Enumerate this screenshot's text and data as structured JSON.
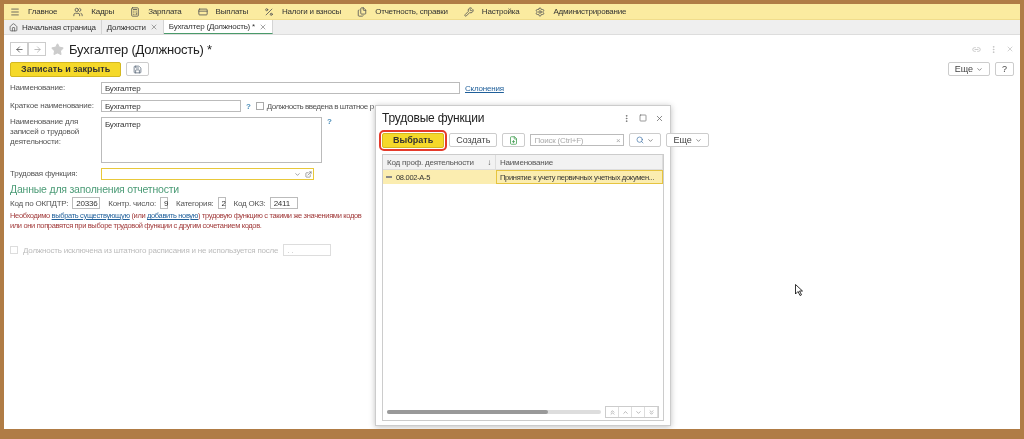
{
  "main_menu": [
    {
      "label": "Главное"
    },
    {
      "label": "Кадры"
    },
    {
      "label": "Зарплата"
    },
    {
      "label": "Выплаты"
    },
    {
      "label": "Налоги и взносы"
    },
    {
      "label": "Отчетность, справки"
    },
    {
      "label": "Настройка"
    },
    {
      "label": "Администрирование"
    }
  ],
  "open_tabs": [
    {
      "label": "Начальная страница",
      "selected": false,
      "closable": false,
      "home": true
    },
    {
      "label": "Должности",
      "selected": false,
      "closable": true,
      "home": false
    },
    {
      "label": "Бухгалтер (Должность) *",
      "selected": true,
      "closable": true,
      "home": false
    }
  ],
  "form": {
    "title": "Бухгалтер (Должность) *",
    "save_close": "Записать и закрыть",
    "more": "Еще",
    "help": "?",
    "name": {
      "label": "Наименование:",
      "value": "Бухгалтер",
      "link": "Склонения"
    },
    "short_name": {
      "label": "Краткое наименование:",
      "value": "Бухгалтер",
      "hint": "?",
      "staff_checkbox": {
        "label": "Должность введена в штатное р",
        "checked": false
      }
    },
    "work_record_name": {
      "label": "Наименование для записей о трудовой деятельности:",
      "value": "Бухгалтер",
      "hint": "?"
    },
    "labor_function": {
      "label": "Трудовая функция:"
    },
    "reporting_header": "Данные для заполнения отчетности",
    "codes": [
      {
        "label": "Код по ОКПДТР:",
        "value": "20336"
      },
      {
        "label": "Контр. число:",
        "value": "9"
      },
      {
        "label": "Категория:",
        "value": "2"
      },
      {
        "label": "Код ОКЗ:",
        "value": "2411"
      }
    ],
    "warning": {
      "before": "Необходимо ",
      "link1": "выбрать существующую",
      "middle1": " (или ",
      "link2": "добавить новую",
      "after": ") трудовую функцию с такими же значениями кодов",
      "line2": "или они поправятся при выборе трудовой функции с другим сочетанием кодов."
    },
    "excluded": {
      "label": "Должность исключена из штатного расписания и не используется после",
      "checked": false,
      "disabled": true,
      "date": ". ."
    }
  },
  "dialog": {
    "title": "Трудовые функции",
    "select": "Выбрать",
    "create": "Создать",
    "search_placeholder": "Поиск (Ctrl+F)",
    "search_clear": "×",
    "more": "Еще",
    "columns": [
      {
        "label": "Код проф. деятельности",
        "sort": "↓"
      },
      {
        "label": "Наименование"
      }
    ],
    "rows": [
      {
        "code": "08.002-А-5",
        "name": "Принятие к учету первичных учетных докумен...",
        "selected": true
      }
    ]
  }
}
